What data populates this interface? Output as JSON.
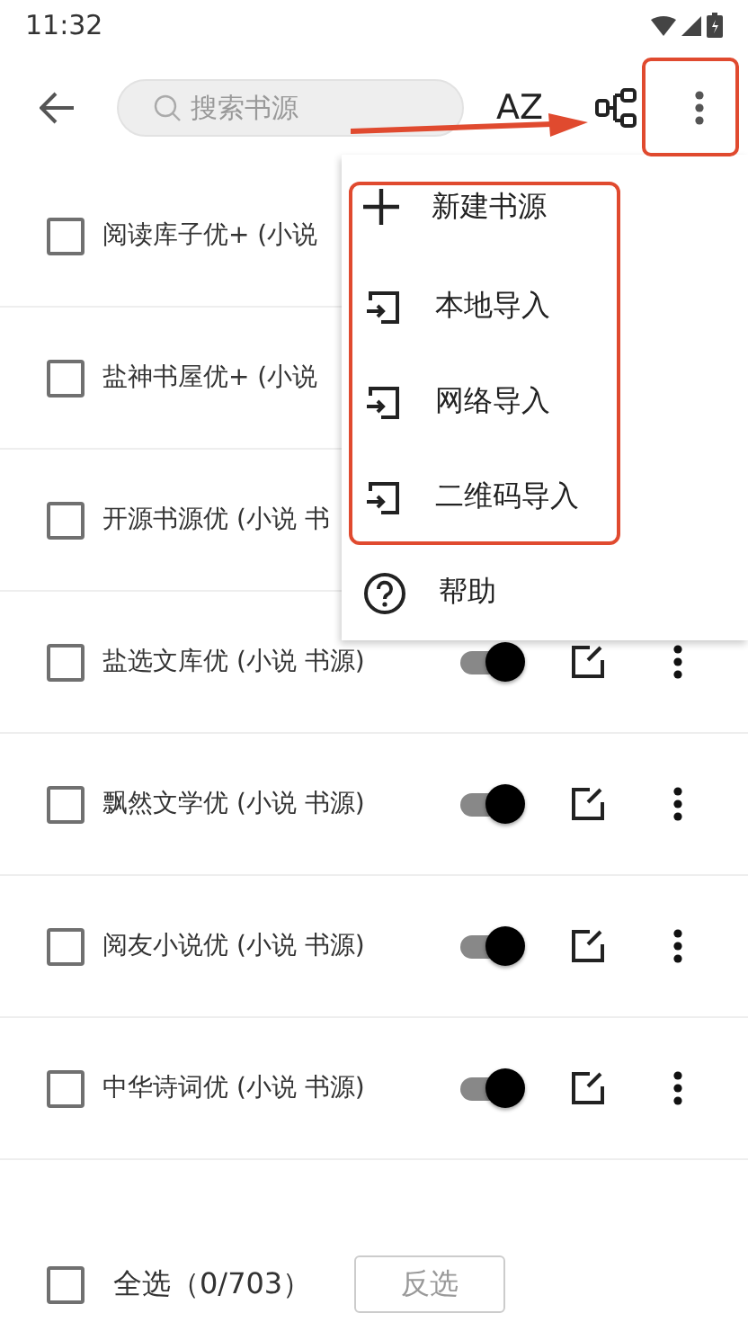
{
  "status_bar": {
    "time": "11:32"
  },
  "toolbar": {
    "search": {
      "placeholder": "搜索书源"
    },
    "sort_label": "AZ"
  },
  "sources": [
    {
      "name": "阅读库子优+ (小说",
      "checked": false
    },
    {
      "name": "盐神书屋优+ (小说",
      "checked": false
    },
    {
      "name": "开源书源优 (小说 书",
      "checked": false
    },
    {
      "name": "盐选文库优 (小说 书源)",
      "checked": false,
      "enabled": true
    },
    {
      "name": "飘然文学优 (小说 书源)",
      "checked": false,
      "enabled": true
    },
    {
      "name": "阅友小说优 (小说 书源)",
      "checked": false,
      "enabled": true
    },
    {
      "name": "中华诗词优 (小说 书源)",
      "checked": false,
      "enabled": true
    }
  ],
  "menu": {
    "items": [
      {
        "kind": "add",
        "label": "新建书源"
      },
      {
        "kind": "import",
        "label": "本地导入"
      },
      {
        "kind": "import",
        "label": "网络导入"
      },
      {
        "kind": "import",
        "label": "二维码导入"
      },
      {
        "kind": "help",
        "label": "帮助"
      }
    ]
  },
  "bottom_bar": {
    "select_all": {
      "label": "全选（0/703）",
      "checked": false
    },
    "buttons": [
      "反选"
    ]
  },
  "callouts": [
    {
      "kind": "arrow"
    },
    {
      "kind": "box_more"
    },
    {
      "kind": "box_menu"
    }
  ]
}
